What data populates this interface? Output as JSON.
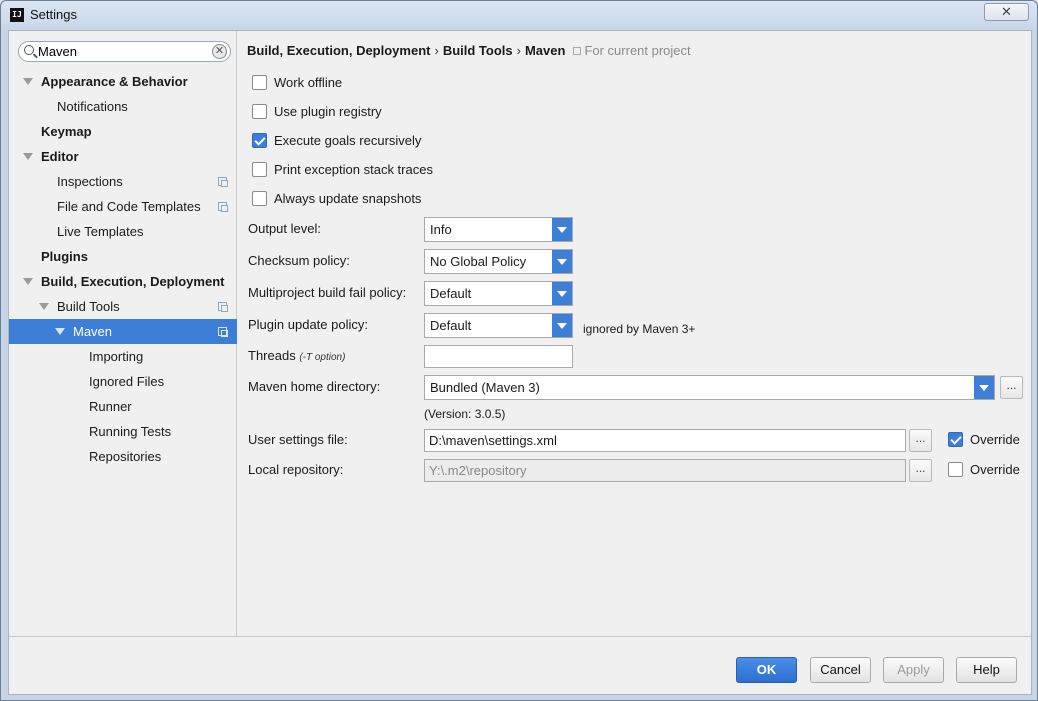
{
  "window": {
    "title": "Settings",
    "app_icon_text": "IJ",
    "close_symbol": "✕"
  },
  "search": {
    "value": "Maven",
    "clear_symbol": "✕"
  },
  "sidebar": {
    "items": [
      {
        "label": "Appearance & Behavior",
        "bold": true,
        "arrow": true,
        "copy": false
      },
      {
        "label": "Notifications",
        "bold": false,
        "arrow": false,
        "copy": false
      },
      {
        "label": "Keymap",
        "bold": true,
        "arrow": false,
        "copy": false
      },
      {
        "label": "Editor",
        "bold": true,
        "arrow": true,
        "copy": false
      },
      {
        "label": "Inspections",
        "bold": false,
        "arrow": false,
        "copy": true
      },
      {
        "label": "File and Code Templates",
        "bold": false,
        "arrow": false,
        "copy": true
      },
      {
        "label": "Live Templates",
        "bold": false,
        "arrow": false,
        "copy": false
      },
      {
        "label": "Plugins",
        "bold": true,
        "arrow": false,
        "copy": false
      },
      {
        "label": "Build, Execution, Deployment",
        "bold": true,
        "arrow": true,
        "copy": false
      },
      {
        "label": "Build Tools",
        "bold": false,
        "arrow": true,
        "copy": true
      },
      {
        "label": "Maven",
        "bold": false,
        "arrow": true,
        "copy": true,
        "selected": true
      },
      {
        "label": "Importing",
        "bold": false,
        "arrow": false,
        "copy": false
      },
      {
        "label": "Ignored Files",
        "bold": false,
        "arrow": false,
        "copy": false
      },
      {
        "label": "Runner",
        "bold": false,
        "arrow": false,
        "copy": false
      },
      {
        "label": "Running Tests",
        "bold": false,
        "arrow": false,
        "copy": false
      },
      {
        "label": "Repositories",
        "bold": false,
        "arrow": false,
        "copy": false
      }
    ]
  },
  "breadcrumb": {
    "parts": [
      "Build, Execution, Deployment",
      "Build Tools",
      "Maven"
    ],
    "separator": "›",
    "scope": "For current project"
  },
  "checkboxes": [
    {
      "label": "Work offline",
      "checked": false
    },
    {
      "label": "Use plugin registry",
      "checked": false
    },
    {
      "label": "Execute goals recursively",
      "checked": true
    },
    {
      "label": "Print exception stack traces",
      "checked": false
    },
    {
      "label": "Always update snapshots",
      "checked": false
    }
  ],
  "form": {
    "output_level": {
      "label": "Output level:",
      "value": "Info"
    },
    "checksum_policy": {
      "label": "Checksum policy:",
      "value": "No Global Policy"
    },
    "fail_policy": {
      "label": "Multiproject build fail policy:",
      "value": "Default"
    },
    "update_policy": {
      "label": "Plugin update policy:",
      "value": "Default",
      "note": "ignored by Maven 3+"
    },
    "threads": {
      "label": "Threads",
      "hint": "(-T option)",
      "value": ""
    },
    "maven_home": {
      "label": "Maven home directory:",
      "value": "Bundled (Maven 3)",
      "version": "(Version: 3.0.5)"
    },
    "user_settings": {
      "label": "User settings file:",
      "value": "D:\\maven\\settings.xml",
      "override_label": "Override",
      "override_checked": true
    },
    "local_repo": {
      "label": "Local repository:",
      "value": "Y:\\.m2\\repository",
      "override_label": "Override",
      "override_checked": false
    },
    "browse_symbol": "..."
  },
  "footer": {
    "ok": "OK",
    "cancel": "Cancel",
    "apply": "Apply",
    "help": "Help"
  },
  "colors": {
    "accent": "#3d7ed7",
    "selection": "#3d7ed7"
  }
}
